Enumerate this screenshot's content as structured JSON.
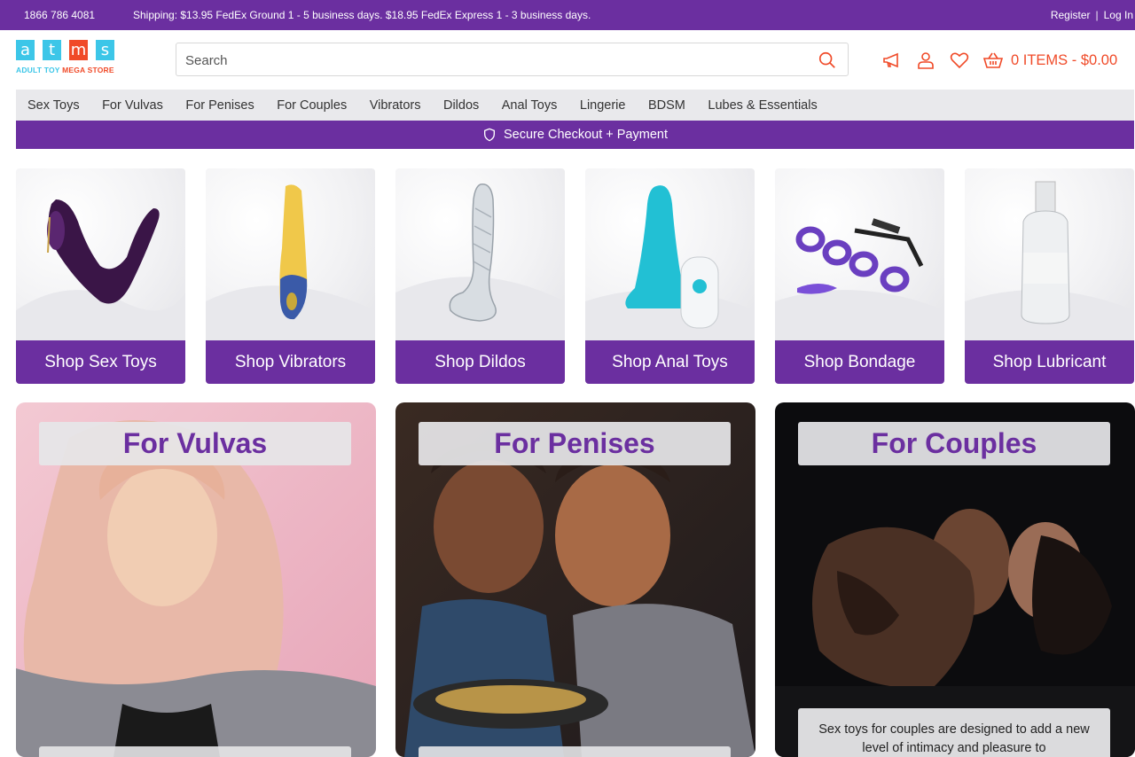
{
  "topbar": {
    "phone": "1866 786 4081",
    "shipping": "Shipping: $13.95 FedEx Ground 1 - 5 business days. $18.95 FedEx Express 1 - 3 business days.",
    "register": "Register",
    "separator": "|",
    "login": "Log In"
  },
  "logo": {
    "letters": [
      "a",
      "t",
      "m",
      "s"
    ],
    "tagline_part1": "ADULT TOY",
    "tagline_part2": "MEGA STORE"
  },
  "search": {
    "placeholder": "Search"
  },
  "header_icons": [
    "megaphone-icon",
    "user-icon",
    "heart-icon",
    "basket-icon"
  ],
  "cart": {
    "text": "0 ITEMS - $0.00"
  },
  "nav": {
    "items": [
      "Sex Toys",
      "For Vulvas",
      "For Penises",
      "For Couples",
      "Vibrators",
      "Dildos",
      "Anal Toys",
      "Lingerie",
      "BDSM",
      "Lubes & Essentials"
    ]
  },
  "secure": {
    "text": "Secure Checkout + Payment"
  },
  "categories": [
    {
      "label": "Shop Sex Toys"
    },
    {
      "label": "Shop Vibrators"
    },
    {
      "label": "Shop Dildos"
    },
    {
      "label": "Shop Anal Toys"
    },
    {
      "label": "Shop Bondage"
    },
    {
      "label": "Shop Lubricant"
    }
  ],
  "panels": [
    {
      "title": "For Vulvas"
    },
    {
      "title": "For Penises"
    },
    {
      "title": "For Couples",
      "description": "Sex toys for couples are designed to add a new level of intimacy and pleasure to"
    }
  ],
  "colors": {
    "brand_purple": "#6b2fa0",
    "accent_orange": "#f04a28",
    "logo_cyan": "#3cc6e8",
    "nav_gray": "#e9e9ec"
  }
}
